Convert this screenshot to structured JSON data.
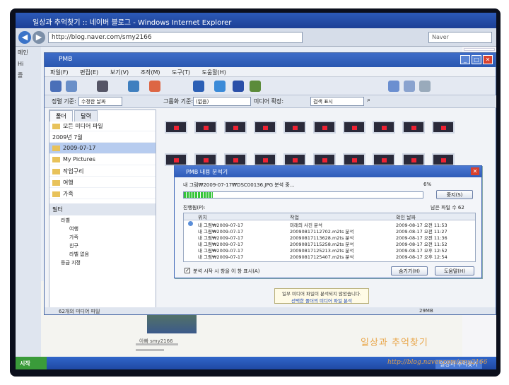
{
  "ie": {
    "title": "일상과 추억찾기 :: 네이버 블로그 - Windows Internet Explorer",
    "url": "http://blog.naver.com/smy2166",
    "search_text": "Naver",
    "left_items": [
      "메인",
      "Hi",
      "즐"
    ]
  },
  "pmb": {
    "title": "PMB",
    "menu": [
      "파일(F)",
      "편집(E)",
      "보기(V)",
      "조작(M)",
      "도구(T)",
      "도움말(H)"
    ],
    "sort_label": "정렬 기준:",
    "sort_value": "수정한 날짜",
    "group_label": "그룹화 기준:",
    "group_value": "(없음)",
    "media_label": "미디어 확장:",
    "search_placeholder": "검색 표시",
    "tabs": [
      "폴더",
      "달력"
    ],
    "tree": [
      {
        "label": "모든 미디어 파일",
        "selected": false
      },
      {
        "label": "2009년 7월",
        "selected": false
      },
      {
        "label": "2009-07-17",
        "selected": true
      },
      {
        "label": "My Pictures",
        "selected": false
      },
      {
        "label": "작업구리",
        "selected": false
      },
      {
        "label": "여행",
        "selected": false
      },
      {
        "label": "가족",
        "selected": false
      }
    ],
    "filter_head": "필터",
    "filter_items": [
      "라벨",
      "여행",
      "가족",
      "친구",
      "라벨 없음",
      "등급 지정"
    ],
    "status_left": "62개의 미디어 파일",
    "status_right": "29MB"
  },
  "dialog": {
    "title": "PMB 내용 분석기",
    "file_text": "내 그림₩2009-07-17₩DSC00136.JPG 분석 중...",
    "percent_text": "6%",
    "progress": 0.12,
    "stop_label": "중지(S)",
    "remaining_text": "남은 파일 수 62",
    "list_label": "진행됨(P):",
    "columns": [
      "위치",
      "작업",
      "확인 날짜"
    ],
    "rows": [
      {
        "loc": "내 그림₩2009-07-17",
        "task": "미래의 사진 분석",
        "date": "2009-08-17 오전 11:53"
      },
      {
        "loc": "내 그림₩2009-07-17",
        "task": "20090817112702.m2ts 분석",
        "date": "2009-08-17 오전 11:27"
      },
      {
        "loc": "내 그림₩2009-07-17",
        "task": "20090817113628.m2ts 분석",
        "date": "2009-08-17 오전 11:36"
      },
      {
        "loc": "내 그림₩2009-07-17",
        "task": "20090817115258.m2ts 분석",
        "date": "2009-08-17 오전 11:52"
      },
      {
        "loc": "내 그림₩2009-07-17",
        "task": "20090817125213.m2ts 분석",
        "date": "2009-08-17 오후 12:52"
      },
      {
        "loc": "내 그림₩2009-07-17",
        "task": "20090817125407.m2ts 분석",
        "date": "2009-08-17 오후 12:54"
      }
    ],
    "checkbox_label": "분석 시작 시 창을 이 창 표시(A)",
    "hide_label": "숨기기(H)",
    "help_label": "도움말(H)"
  },
  "notice": {
    "line1": "일부 미디어 파일이 분석되지 않았습니다.",
    "link": "선택한 폴더의 미디어 파일 분석"
  },
  "blog": {
    "user": "아빠 smy2166"
  },
  "taskbar": {
    "start": "시작",
    "item": "일상과 추억찾기"
  },
  "watermark": {
    "text": "일상과 추억찾기",
    "url": "http://blog.naver.com/smy2166"
  }
}
